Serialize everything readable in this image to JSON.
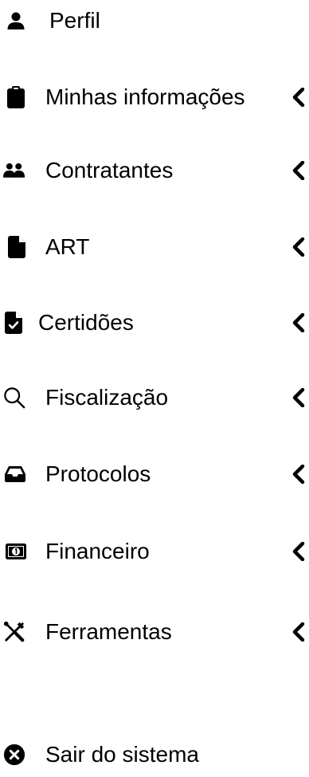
{
  "menu": {
    "items": [
      {
        "label": "Perfil",
        "icon": "user-icon",
        "has_submenu": false
      },
      {
        "label": "Minhas informações",
        "icon": "clipboard-icon",
        "has_submenu": true
      },
      {
        "label": "Contratantes",
        "icon": "users-icon",
        "has_submenu": true
      },
      {
        "label": "ART",
        "icon": "file-icon",
        "has_submenu": true
      },
      {
        "label": "Certidões",
        "icon": "file-check-icon",
        "has_submenu": true
      },
      {
        "label": "Fiscalização",
        "icon": "search-icon",
        "has_submenu": true
      },
      {
        "label": "Protocolos",
        "icon": "inbox-icon",
        "has_submenu": true
      },
      {
        "label": "Financeiro",
        "icon": "money-bill-icon",
        "has_submenu": true
      },
      {
        "label": "Ferramentas",
        "icon": "tools-icon",
        "has_submenu": true
      },
      {
        "label": "Sair do sistema",
        "icon": "times-circle-icon",
        "has_submenu": false
      }
    ]
  },
  "colors": {
    "text": "#000000",
    "background": "#ffffff"
  }
}
